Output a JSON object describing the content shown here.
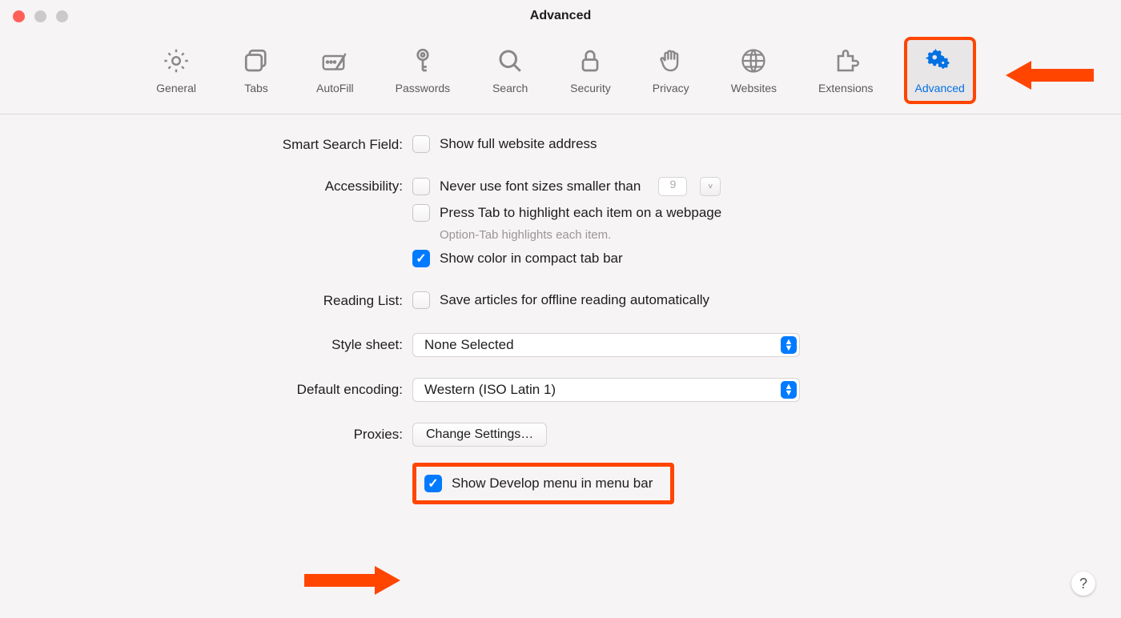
{
  "window": {
    "title": "Advanced"
  },
  "toolbar": {
    "items": [
      {
        "label": "General",
        "icon": "gear-icon"
      },
      {
        "label": "Tabs",
        "icon": "tabs-icon"
      },
      {
        "label": "AutoFill",
        "icon": "autofill-icon"
      },
      {
        "label": "Passwords",
        "icon": "key-icon"
      },
      {
        "label": "Search",
        "icon": "search-icon"
      },
      {
        "label": "Security",
        "icon": "lock-icon"
      },
      {
        "label": "Privacy",
        "icon": "hand-icon"
      },
      {
        "label": "Websites",
        "icon": "globe-icon"
      },
      {
        "label": "Extensions",
        "icon": "puzzle-icon"
      },
      {
        "label": "Advanced",
        "icon": "double-gear-icon"
      }
    ],
    "active_index": 9
  },
  "sections": {
    "smart_search": {
      "label": "Smart Search Field:",
      "opt1": "Show full website address",
      "opt1_checked": false
    },
    "accessibility": {
      "label": "Accessibility:",
      "opt1": "Never use font sizes smaller than",
      "opt1_checked": false,
      "font_size_value": "9",
      "opt2": "Press Tab to highlight each item on a webpage",
      "opt2_checked": false,
      "hint": "Option-Tab highlights each item.",
      "opt3": "Show color in compact tab bar",
      "opt3_checked": true
    },
    "reading_list": {
      "label": "Reading List:",
      "opt1": "Save articles for offline reading automatically",
      "opt1_checked": false
    },
    "style_sheet": {
      "label": "Style sheet:",
      "value": "None Selected"
    },
    "default_encoding": {
      "label": "Default encoding:",
      "value": "Western (ISO Latin 1)"
    },
    "proxies": {
      "label": "Proxies:",
      "button": "Change Settings…"
    },
    "develop": {
      "label": "Show Develop menu in menu bar",
      "checked": true
    }
  },
  "help": "?"
}
